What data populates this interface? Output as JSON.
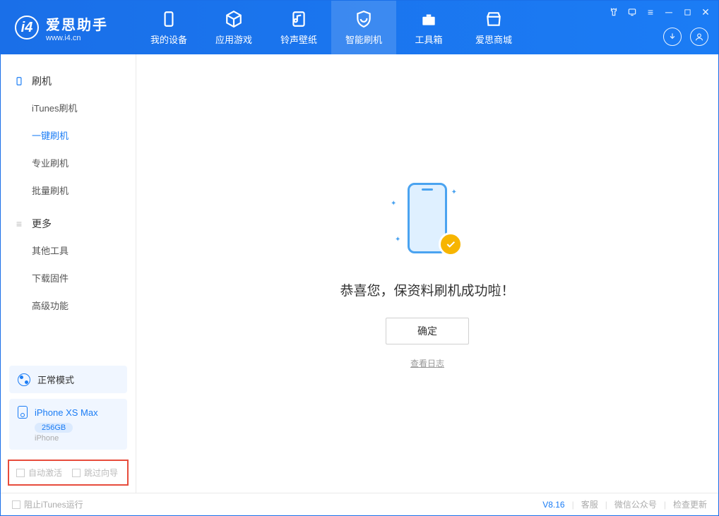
{
  "app": {
    "title": "爱思助手",
    "subtitle": "www.i4.cn"
  },
  "nav": {
    "tabs": [
      {
        "label": "我的设备"
      },
      {
        "label": "应用游戏"
      },
      {
        "label": "铃声壁纸"
      },
      {
        "label": "智能刷机"
      },
      {
        "label": "工具箱"
      },
      {
        "label": "爱思商城"
      }
    ]
  },
  "sidebar": {
    "section1": {
      "title": "刷机",
      "items": [
        "iTunes刷机",
        "一键刷机",
        "专业刷机",
        "批量刷机"
      ]
    },
    "section2": {
      "title": "更多",
      "items": [
        "其他工具",
        "下载固件",
        "高级功能"
      ]
    },
    "mode": "正常模式",
    "device": {
      "name": "iPhone XS Max",
      "capacity": "256GB",
      "type": "iPhone"
    },
    "checks": {
      "auto_activate": "自动激活",
      "skip_guide": "跳过向导"
    }
  },
  "main": {
    "success_text": "恭喜您，保资料刷机成功啦！",
    "ok_button": "确定",
    "view_log": "查看日志"
  },
  "status": {
    "stop_itunes": "阻止iTunes运行",
    "version": "V8.16",
    "links": [
      "客服",
      "微信公众号",
      "检查更新"
    ]
  }
}
